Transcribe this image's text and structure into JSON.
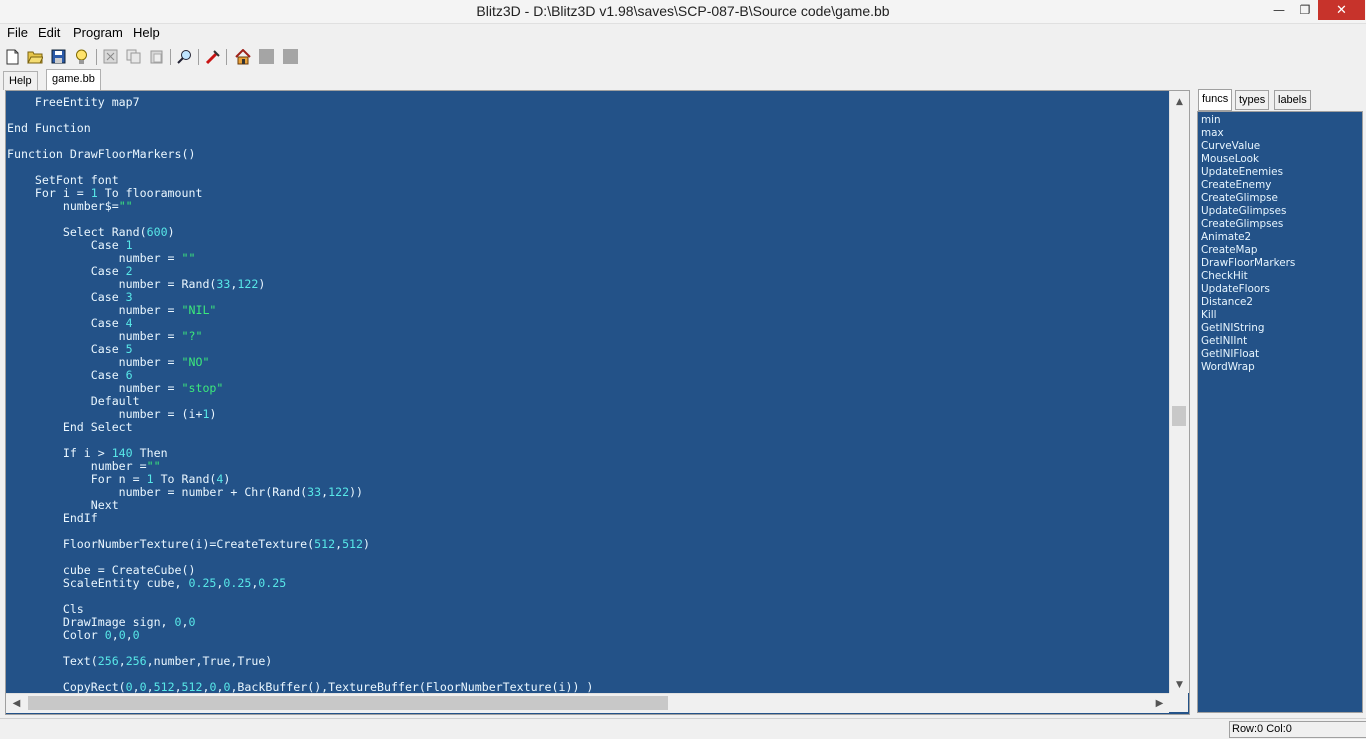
{
  "window": {
    "title": "Blitz3D - D:\\Blitz3D v1.98\\saves\\SCP-087-B\\Source code\\game.bb",
    "minimize": "—",
    "maximize": "❐",
    "close": "✕"
  },
  "menu": [
    "File",
    "Edit",
    "Program",
    "Help"
  ],
  "toolbar": [
    {
      "icon": "new-file-icon"
    },
    {
      "icon": "open-folder-icon"
    },
    {
      "icon": "save-icon"
    },
    {
      "icon": "close-file-icon"
    },
    {
      "icon": "cut-icon"
    },
    {
      "icon": "copy-icon"
    },
    {
      "icon": "paste-icon"
    },
    {
      "icon": "find-icon"
    },
    {
      "icon": "run-icon"
    },
    {
      "icon": "home-icon"
    },
    {
      "icon": "back-icon"
    },
    {
      "icon": "forward-icon"
    }
  ],
  "tabs": [
    {
      "label": "Help",
      "active": false
    },
    {
      "label": "game.bb",
      "active": true
    }
  ],
  "editor": {
    "lines": [
      [
        [
          "    FreeEntity map7",
          ""
        ]
      ],
      [
        [
          "",
          ""
        ]
      ],
      [
        [
          "End Function",
          ""
        ]
      ],
      [
        [
          "",
          ""
        ]
      ],
      [
        [
          "Function DrawFloorMarkers()",
          ""
        ]
      ],
      [
        [
          "",
          ""
        ]
      ],
      [
        [
          "    SetFont font",
          ""
        ]
      ],
      [
        [
          "    For i = ",
          ""
        ],
        [
          "1",
          "num"
        ],
        [
          " To flooramount",
          ""
        ]
      ],
      [
        [
          "        number$=",
          ""
        ],
        [
          "\"\"",
          "str"
        ]
      ],
      [
        [
          "",
          ""
        ]
      ],
      [
        [
          "        Select Rand(",
          ""
        ],
        [
          "600",
          "num"
        ],
        [
          ")",
          ""
        ]
      ],
      [
        [
          "            Case ",
          ""
        ],
        [
          "1",
          "num"
        ]
      ],
      [
        [
          "                number = ",
          ""
        ],
        [
          "\"\"",
          "str"
        ]
      ],
      [
        [
          "            Case ",
          ""
        ],
        [
          "2",
          "num"
        ]
      ],
      [
        [
          "                number = Rand(",
          ""
        ],
        [
          "33",
          "num"
        ],
        [
          ",",
          ""
        ],
        [
          "122",
          "num"
        ],
        [
          ")",
          ""
        ]
      ],
      [
        [
          "            Case ",
          ""
        ],
        [
          "3",
          "num"
        ]
      ],
      [
        [
          "                number = ",
          ""
        ],
        [
          "\"NIL\"",
          "str"
        ]
      ],
      [
        [
          "            Case ",
          ""
        ],
        [
          "4",
          "num"
        ]
      ],
      [
        [
          "                number = ",
          ""
        ],
        [
          "\"?\"",
          "str"
        ]
      ],
      [
        [
          "            Case ",
          ""
        ],
        [
          "5",
          "num"
        ]
      ],
      [
        [
          "                number = ",
          ""
        ],
        [
          "\"NO\"",
          "str"
        ]
      ],
      [
        [
          "            Case ",
          ""
        ],
        [
          "6",
          "num"
        ]
      ],
      [
        [
          "                number = ",
          ""
        ],
        [
          "\"stop\"",
          "str"
        ]
      ],
      [
        [
          "            Default",
          ""
        ]
      ],
      [
        [
          "                number = (i+",
          ""
        ],
        [
          "1",
          "num"
        ],
        [
          ")",
          ""
        ]
      ],
      [
        [
          "        End Select",
          ""
        ]
      ],
      [
        [
          "",
          ""
        ]
      ],
      [
        [
          "        If i > ",
          ""
        ],
        [
          "140",
          "num"
        ],
        [
          " Then",
          ""
        ]
      ],
      [
        [
          "            number =",
          ""
        ],
        [
          "\"\"",
          "str"
        ]
      ],
      [
        [
          "            For n = ",
          ""
        ],
        [
          "1",
          "num"
        ],
        [
          " To Rand(",
          ""
        ],
        [
          "4",
          "num"
        ],
        [
          ")",
          ""
        ]
      ],
      [
        [
          "                number = number + Chr(Rand(",
          ""
        ],
        [
          "33",
          "num"
        ],
        [
          ",",
          ""
        ],
        [
          "122",
          "num"
        ],
        [
          "))",
          ""
        ]
      ],
      [
        [
          "            Next",
          ""
        ]
      ],
      [
        [
          "        EndIf",
          ""
        ]
      ],
      [
        [
          "",
          ""
        ]
      ],
      [
        [
          "        FloorNumberTexture(i)=CreateTexture(",
          ""
        ],
        [
          "512",
          "num"
        ],
        [
          ",",
          ""
        ],
        [
          "512",
          "num"
        ],
        [
          ")",
          ""
        ]
      ],
      [
        [
          "",
          ""
        ]
      ],
      [
        [
          "        cube = CreateCube()",
          ""
        ]
      ],
      [
        [
          "        ScaleEntity cube, ",
          ""
        ],
        [
          "0.25",
          "num"
        ],
        [
          ",",
          ""
        ],
        [
          "0.25",
          "num"
        ],
        [
          ",",
          ""
        ],
        [
          "0.25",
          "num"
        ]
      ],
      [
        [
          "",
          ""
        ]
      ],
      [
        [
          "        Cls",
          ""
        ]
      ],
      [
        [
          "        DrawImage sign, ",
          ""
        ],
        [
          "0",
          "num"
        ],
        [
          ",",
          ""
        ],
        [
          "0",
          "num"
        ]
      ],
      [
        [
          "        Color ",
          ""
        ],
        [
          "0",
          "num"
        ],
        [
          ",",
          ""
        ],
        [
          "0",
          "num"
        ],
        [
          ",",
          ""
        ],
        [
          "0",
          "num"
        ]
      ],
      [
        [
          "",
          ""
        ]
      ],
      [
        [
          "        Text(",
          ""
        ],
        [
          "256",
          "num"
        ],
        [
          ",",
          ""
        ],
        [
          "256",
          "num"
        ],
        [
          ",number,True,True)",
          ""
        ]
      ],
      [
        [
          "",
          ""
        ]
      ],
      [
        [
          "        CopyRect(",
          ""
        ],
        [
          "0",
          "num"
        ],
        [
          ",",
          ""
        ],
        [
          "0",
          "num"
        ],
        [
          ",",
          ""
        ],
        [
          "512",
          "num"
        ],
        [
          ",",
          ""
        ],
        [
          "512",
          "num"
        ],
        [
          ",",
          ""
        ],
        [
          "0",
          "num"
        ],
        [
          ",",
          ""
        ],
        [
          "0",
          "num"
        ],
        [
          ",BackBuffer(),TextureBuffer(FloorNumberTexture(i)) )",
          ""
        ]
      ]
    ]
  },
  "side_tabs": [
    {
      "label": "funcs",
      "active": true
    },
    {
      "label": "types",
      "active": false
    },
    {
      "label": "labels",
      "active": false
    }
  ],
  "funcs": [
    "min",
    "max",
    "CurveValue",
    "MouseLook",
    "UpdateEnemies",
    "CreateEnemy",
    "CreateGlimpse",
    "UpdateGlimpses",
    "CreateGlimpses",
    "Animate2",
    "CreateMap",
    "DrawFloorMarkers",
    "CheckHit",
    "UpdateFloors",
    "Distance2",
    "Kill",
    "GetINIString",
    "GetINIInt",
    "GetINIFloat",
    "WordWrap"
  ],
  "status": "Row:0 Col:0"
}
